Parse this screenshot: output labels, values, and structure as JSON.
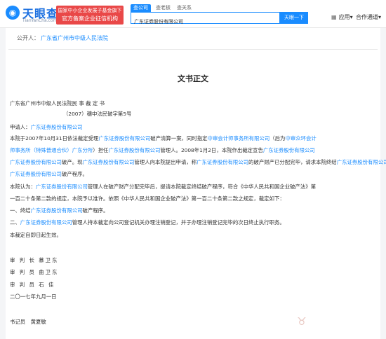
{
  "header": {
    "logo_cn": "天眼查",
    "logo_en": "TianYanCha.com",
    "promo_line1": "国家中小企业发展子基金旗下",
    "promo_line2": "官方备案企业征信机构",
    "tabs": [
      "查公司",
      "查老板",
      "查关系"
    ],
    "active_tab": 0,
    "search_value": "广东证券股份有限公司",
    "search_button": "天眼一下",
    "nav_app_icon": "grid-icon",
    "nav_app": "应用",
    "nav_app_arrow": "▾",
    "nav_channel": "合作通道",
    "nav_channel_arrow": "▾"
  },
  "announcer": {
    "label": "公开人：",
    "value": "广东省广州市中级人民法院"
  },
  "document": {
    "title": "文书正文",
    "court_line": "广东省广州市中级人民法院民 事 裁 定 书",
    "case_no": "（2007）穗中法民破字第5号",
    "applicant_label": "申请人：",
    "company": "广东证券股份有限公司",
    "p1_a": "本院于2007年10月31日依法裁定受理",
    "p1_b": "破产清算一案，同时指定",
    "p1_firm": "中审会计师事务所有限公司",
    "p1_c": "（后为",
    "p1_firm2a": "中审众环会计",
    "p1_firm2b": "师事务所（特殊普通合伙）广东分所",
    "p1_d": "）担任",
    "p1_e": "管理人。2008年1月2日，本院作出裁定宣告",
    "p1_f": "破产。现",
    "p1_g": "管理人向本院提出申请，称",
    "p1_h": "的破产财产已分配完毕，请求本院终结",
    "p1_i": "破产程序。",
    "p2_a": "本院认为：",
    "p2_b": "管理人在破产财产分配完毕后，提请本院裁定终结破产程序，符合《中华人民共和国企业破产法》第",
    "p2_c": "一百二十条第二款的规定，本院予以准许。依照《中华人民共和国企业破产法》第一百二十条第二款之规定，裁定如下：",
    "r1_a": "一、终结",
    "r1_b": "破产程序。",
    "r2_a": "二、",
    "r2_b": "管理人持本裁定向公司登记机关办理注销登记，并于办理注销登记完毕的次日终止执行职务。",
    "effective": "本裁定自即日起生效。",
    "judge1": "审 判 长 慕卫东",
    "judge2": "审 判 员 曲卫东",
    "judge3": "审 判 员 石 佳",
    "date": "二〇一七年九月一日",
    "clerk": "书记员　黄夏敏"
  },
  "colors": {
    "brand_blue": "#1a8cff",
    "promo_red": "#e94848"
  }
}
